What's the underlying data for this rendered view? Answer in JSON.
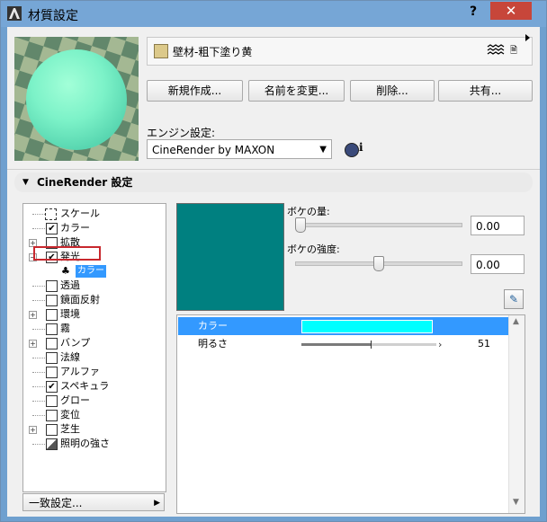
{
  "window": {
    "title": "材質設定",
    "help_label": "?",
    "close_label": "✕"
  },
  "material": {
    "name": "壁材-粗下塗り黄",
    "swatch_color": "#dcc98a"
  },
  "actions": {
    "new": "新規作成...",
    "rename": "名前を変更...",
    "delete": "削除...",
    "share": "共有..."
  },
  "engine": {
    "label": "エンジン設定:",
    "selected": "CineRender by MAXON",
    "info_label": "i"
  },
  "section": {
    "title": "CineRender 設定"
  },
  "channels": [
    {
      "label": "スケール",
      "checked": false,
      "expandable": false,
      "icon": "scale-icon"
    },
    {
      "label": "カラー",
      "checked": true,
      "expandable": false
    },
    {
      "label": "拡散",
      "checked": false,
      "expandable": true
    },
    {
      "label": "発光",
      "checked": true,
      "expandable": true,
      "expanded": true,
      "highlighted": true
    },
    {
      "label": "カラー",
      "sub": true,
      "selected": true
    },
    {
      "label": "透過",
      "checked": false,
      "expandable": false
    },
    {
      "label": "鏡面反射",
      "checked": false,
      "expandable": false
    },
    {
      "label": "環境",
      "checked": false,
      "expandable": true
    },
    {
      "label": "霧",
      "checked": false,
      "expandable": false
    },
    {
      "label": "バンプ",
      "checked": false,
      "expandable": true
    },
    {
      "label": "法線",
      "checked": false,
      "expandable": false
    },
    {
      "label": "アルファ",
      "checked": false,
      "expandable": false
    },
    {
      "label": "スペキュラ",
      "checked": true,
      "expandable": false
    },
    {
      "label": "グロー",
      "checked": false,
      "expandable": false
    },
    {
      "label": "変位",
      "checked": false,
      "expandable": false
    },
    {
      "label": "芝生",
      "checked": false,
      "expandable": true
    },
    {
      "label": "照明の強さ",
      "checked": false,
      "expandable": false,
      "icon": "light-icon"
    }
  ],
  "consistency_button": "一致設定...",
  "emission": {
    "color": "#008080",
    "bokeh_amount": {
      "label": "ボケの量:",
      "value": "0.00",
      "level": 0.0
    },
    "bokeh_strength": {
      "label": "ボケの強度:",
      "value": "0.00",
      "level": 0.5
    }
  },
  "properties": [
    {
      "name": "カラー",
      "color": "#00ffff",
      "selected": true
    },
    {
      "name": "明るさ",
      "value": "51",
      "level": 0.51
    }
  ]
}
